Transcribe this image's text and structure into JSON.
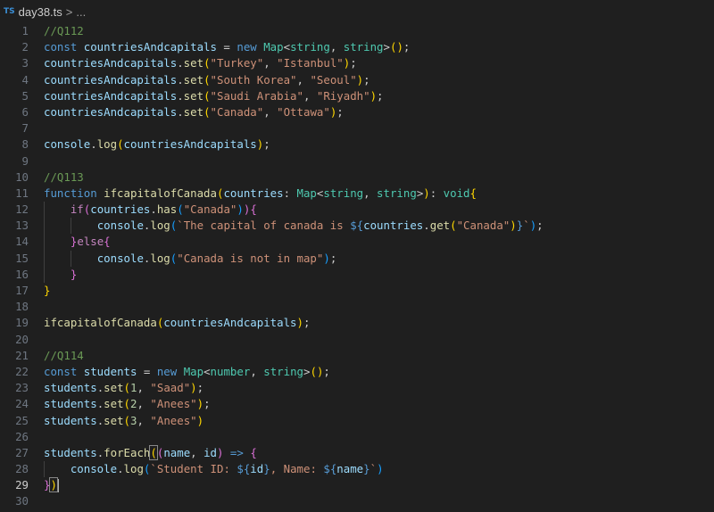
{
  "breadcrumb": {
    "file_icon": "TS",
    "file_name": "day38.ts",
    "separator": ">",
    "trail": "..."
  },
  "colors": {
    "background": "#1f1f1f",
    "comment": "#6a9955",
    "keyword": "#569cd6",
    "control": "#c586c0",
    "variable": "#9cdcfe",
    "function": "#dcdcaa",
    "type": "#4ec9b0",
    "string": "#ce9178",
    "number": "#b5cea8"
  },
  "active_line": 29,
  "lines": [
    {
      "n": "1",
      "tokens": [
        [
          "t-comment",
          "//Q112"
        ]
      ]
    },
    {
      "n": "2",
      "tokens": [
        [
          "t-key",
          "const "
        ],
        [
          "t-var",
          "countriesAndcapitals"
        ],
        [
          "t-p",
          " = "
        ],
        [
          "t-key",
          "new "
        ],
        [
          "t-type",
          "Map"
        ],
        [
          "t-p",
          "<"
        ],
        [
          "t-type",
          "string"
        ],
        [
          "t-p",
          ", "
        ],
        [
          "t-type",
          "string"
        ],
        [
          "t-p",
          ">"
        ],
        [
          "br1",
          "("
        ],
        [
          "br1",
          ")"
        ],
        [
          "t-p",
          ";"
        ]
      ]
    },
    {
      "n": "3",
      "tokens": [
        [
          "t-var",
          "countriesAndcapitals"
        ],
        [
          "t-p",
          "."
        ],
        [
          "t-fn",
          "set"
        ],
        [
          "br1",
          "("
        ],
        [
          "t-str",
          "\"Turkey\""
        ],
        [
          "t-p",
          ", "
        ],
        [
          "t-str",
          "\"Istanbul\""
        ],
        [
          "br1",
          ")"
        ],
        [
          "t-p",
          ";"
        ]
      ]
    },
    {
      "n": "4",
      "tokens": [
        [
          "t-var",
          "countriesAndcapitals"
        ],
        [
          "t-p",
          "."
        ],
        [
          "t-fn",
          "set"
        ],
        [
          "br1",
          "("
        ],
        [
          "t-str",
          "\"South Korea\""
        ],
        [
          "t-p",
          ", "
        ],
        [
          "t-str",
          "\"Seoul\""
        ],
        [
          "br1",
          ")"
        ],
        [
          "t-p",
          ";"
        ]
      ]
    },
    {
      "n": "5",
      "tokens": [
        [
          "t-var",
          "countriesAndcapitals"
        ],
        [
          "t-p",
          "."
        ],
        [
          "t-fn",
          "set"
        ],
        [
          "br1",
          "("
        ],
        [
          "t-str",
          "\"Saudi Arabia\""
        ],
        [
          "t-p",
          ", "
        ],
        [
          "t-str",
          "\"Riyadh\""
        ],
        [
          "br1",
          ")"
        ],
        [
          "t-p",
          ";"
        ]
      ]
    },
    {
      "n": "6",
      "tokens": [
        [
          "t-var",
          "countriesAndcapitals"
        ],
        [
          "t-p",
          "."
        ],
        [
          "t-fn",
          "set"
        ],
        [
          "br1",
          "("
        ],
        [
          "t-str",
          "\"Canada\""
        ],
        [
          "t-p",
          ", "
        ],
        [
          "t-str",
          "\"Ottawa\""
        ],
        [
          "br1",
          ")"
        ],
        [
          "t-p",
          ";"
        ]
      ]
    },
    {
      "n": "7",
      "tokens": []
    },
    {
      "n": "8",
      "tokens": [
        [
          "t-var",
          "console"
        ],
        [
          "t-p",
          "."
        ],
        [
          "t-fn",
          "log"
        ],
        [
          "br1",
          "("
        ],
        [
          "t-var",
          "countriesAndcapitals"
        ],
        [
          "br1",
          ")"
        ],
        [
          "t-p",
          ";"
        ]
      ]
    },
    {
      "n": "9",
      "tokens": []
    },
    {
      "n": "10",
      "tokens": [
        [
          "t-comment",
          "//Q113"
        ]
      ]
    },
    {
      "n": "11",
      "tokens": [
        [
          "t-key",
          "function "
        ],
        [
          "t-fn",
          "ifcapitalofCanada"
        ],
        [
          "br1",
          "("
        ],
        [
          "t-var",
          "countries"
        ],
        [
          "t-p",
          ": "
        ],
        [
          "t-type",
          "Map"
        ],
        [
          "t-p",
          "<"
        ],
        [
          "t-type",
          "string"
        ],
        [
          "t-p",
          ", "
        ],
        [
          "t-type",
          "string"
        ],
        [
          "t-p",
          ">"
        ],
        [
          "br1",
          ")"
        ],
        [
          "t-p",
          ": "
        ],
        [
          "t-type",
          "void"
        ],
        [
          "br1",
          "{"
        ]
      ]
    },
    {
      "n": "12",
      "tokens": [
        [
          "t-p",
          "    "
        ],
        [
          "t-ctrl",
          "if"
        ],
        [
          "br2",
          "("
        ],
        [
          "t-var",
          "countries"
        ],
        [
          "t-p",
          "."
        ],
        [
          "t-fn",
          "has"
        ],
        [
          "br3",
          "("
        ],
        [
          "t-str",
          "\"Canada\""
        ],
        [
          "br3",
          ")"
        ],
        [
          "br2",
          ")"
        ],
        [
          "br2",
          "{"
        ]
      ]
    },
    {
      "n": "13",
      "tokens": [
        [
          "t-p",
          "        "
        ],
        [
          "t-var",
          "console"
        ],
        [
          "t-p",
          "."
        ],
        [
          "t-fn",
          "log"
        ],
        [
          "br3",
          "("
        ],
        [
          "t-str",
          "`The capital of canada is "
        ],
        [
          "t-key",
          "${"
        ],
        [
          "t-var",
          "countries"
        ],
        [
          "t-p",
          "."
        ],
        [
          "t-fn",
          "get"
        ],
        [
          "br1",
          "("
        ],
        [
          "t-str",
          "\"Canada\""
        ],
        [
          "br1",
          ")"
        ],
        [
          "t-key",
          "}"
        ],
        [
          "t-str",
          "`"
        ],
        [
          "br3",
          ")"
        ],
        [
          "t-p",
          ";"
        ]
      ]
    },
    {
      "n": "14",
      "tokens": [
        [
          "t-p",
          "    "
        ],
        [
          "br2",
          "}"
        ],
        [
          "t-ctrl",
          "else"
        ],
        [
          "br2",
          "{"
        ]
      ]
    },
    {
      "n": "15",
      "tokens": [
        [
          "t-p",
          "        "
        ],
        [
          "t-var",
          "console"
        ],
        [
          "t-p",
          "."
        ],
        [
          "t-fn",
          "log"
        ],
        [
          "br3",
          "("
        ],
        [
          "t-str",
          "\"Canada is not in map\""
        ],
        [
          "br3",
          ")"
        ],
        [
          "t-p",
          ";"
        ]
      ]
    },
    {
      "n": "16",
      "tokens": [
        [
          "t-p",
          "    "
        ],
        [
          "br2",
          "}"
        ]
      ]
    },
    {
      "n": "17",
      "tokens": [
        [
          "br1",
          "}"
        ]
      ]
    },
    {
      "n": "18",
      "tokens": []
    },
    {
      "n": "19",
      "tokens": [
        [
          "t-fn",
          "ifcapitalofCanada"
        ],
        [
          "br1",
          "("
        ],
        [
          "t-var",
          "countriesAndcapitals"
        ],
        [
          "br1",
          ")"
        ],
        [
          "t-p",
          ";"
        ]
      ]
    },
    {
      "n": "20",
      "tokens": []
    },
    {
      "n": "21",
      "tokens": [
        [
          "t-comment",
          "//Q114"
        ]
      ]
    },
    {
      "n": "22",
      "tokens": [
        [
          "t-key",
          "const "
        ],
        [
          "t-var",
          "students"
        ],
        [
          "t-p",
          " = "
        ],
        [
          "t-key",
          "new "
        ],
        [
          "t-type",
          "Map"
        ],
        [
          "t-p",
          "<"
        ],
        [
          "t-type",
          "number"
        ],
        [
          "t-p",
          ", "
        ],
        [
          "t-type",
          "string"
        ],
        [
          "t-p",
          ">"
        ],
        [
          "br1",
          "("
        ],
        [
          "br1",
          ")"
        ],
        [
          "t-p",
          ";"
        ]
      ]
    },
    {
      "n": "23",
      "tokens": [
        [
          "t-var",
          "students"
        ],
        [
          "t-p",
          "."
        ],
        [
          "t-fn",
          "set"
        ],
        [
          "br1",
          "("
        ],
        [
          "t-num",
          "1"
        ],
        [
          "t-p",
          ", "
        ],
        [
          "t-str",
          "\"Saad\""
        ],
        [
          "br1",
          ")"
        ],
        [
          "t-p",
          ";"
        ]
      ]
    },
    {
      "n": "24",
      "tokens": [
        [
          "t-var",
          "students"
        ],
        [
          "t-p",
          "."
        ],
        [
          "t-fn",
          "set"
        ],
        [
          "br1",
          "("
        ],
        [
          "t-num",
          "2"
        ],
        [
          "t-p",
          ", "
        ],
        [
          "t-str",
          "\"Anees\""
        ],
        [
          "br1",
          ")"
        ],
        [
          "t-p",
          ";"
        ]
      ]
    },
    {
      "n": "25",
      "tokens": [
        [
          "t-var",
          "students"
        ],
        [
          "t-p",
          "."
        ],
        [
          "t-fn",
          "set"
        ],
        [
          "br1",
          "("
        ],
        [
          "t-num",
          "3"
        ],
        [
          "t-p",
          ", "
        ],
        [
          "t-str",
          "\"Anees\""
        ],
        [
          "br1",
          ")"
        ]
      ]
    },
    {
      "n": "26",
      "tokens": []
    },
    {
      "n": "27",
      "tokens": [
        [
          "t-var",
          "students"
        ],
        [
          "t-p",
          "."
        ],
        [
          "t-fn",
          "forEach"
        ],
        [
          "br1 matchbox",
          "("
        ],
        [
          "br2",
          "("
        ],
        [
          "t-var",
          "name"
        ],
        [
          "t-p",
          ", "
        ],
        [
          "t-var",
          "id"
        ],
        [
          "br2",
          ")"
        ],
        [
          "t-key",
          " => "
        ],
        [
          "br2",
          "{"
        ]
      ]
    },
    {
      "n": "28",
      "tokens": [
        [
          "t-p",
          "    "
        ],
        [
          "t-var",
          "console"
        ],
        [
          "t-p",
          "."
        ],
        [
          "t-fn",
          "log"
        ],
        [
          "br3",
          "("
        ],
        [
          "t-str",
          "`Student ID: "
        ],
        [
          "t-key",
          "${"
        ],
        [
          "t-var",
          "id"
        ],
        [
          "t-key",
          "}"
        ],
        [
          "t-str",
          ", Name: "
        ],
        [
          "t-key",
          "${"
        ],
        [
          "t-var",
          "name"
        ],
        [
          "t-key",
          "}"
        ],
        [
          "t-str",
          "`"
        ],
        [
          "br3",
          ")"
        ]
      ]
    },
    {
      "n": "29",
      "tokens": [
        [
          "br2",
          "}"
        ],
        [
          "br1 matchbox",
          ")"
        ],
        [
          "cursor",
          ""
        ]
      ]
    },
    {
      "n": "30",
      "tokens": []
    }
  ]
}
